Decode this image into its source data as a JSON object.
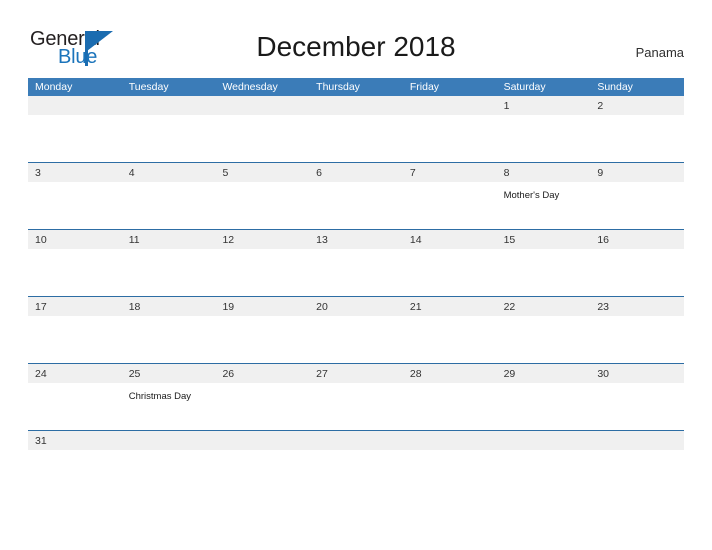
{
  "logo": {
    "text_primary": "General",
    "text_secondary": "Blue",
    "triangle_icon": "triangle-icon"
  },
  "header": {
    "title": "December 2018",
    "country": "Panama"
  },
  "colors": {
    "header_blue": "#3b7cb8",
    "row_border_blue": "#2d6da4",
    "date_band_gray": "#f0f0f0",
    "logo_blue": "#1b74bb",
    "text_dark": "#333333"
  },
  "calendar": {
    "month": "December",
    "year": "2018",
    "weekdays": [
      "Monday",
      "Tuesday",
      "Wednesday",
      "Thursday",
      "Friday",
      "Saturday",
      "Sunday"
    ],
    "weeks": [
      {
        "days": [
          {
            "num": "",
            "event": ""
          },
          {
            "num": "",
            "event": ""
          },
          {
            "num": "",
            "event": ""
          },
          {
            "num": "",
            "event": ""
          },
          {
            "num": "",
            "event": ""
          },
          {
            "num": "1",
            "event": ""
          },
          {
            "num": "2",
            "event": ""
          }
        ]
      },
      {
        "days": [
          {
            "num": "3",
            "event": ""
          },
          {
            "num": "4",
            "event": ""
          },
          {
            "num": "5",
            "event": ""
          },
          {
            "num": "6",
            "event": ""
          },
          {
            "num": "7",
            "event": ""
          },
          {
            "num": "8",
            "event": "Mother's Day"
          },
          {
            "num": "9",
            "event": ""
          }
        ]
      },
      {
        "days": [
          {
            "num": "10",
            "event": ""
          },
          {
            "num": "11",
            "event": ""
          },
          {
            "num": "12",
            "event": ""
          },
          {
            "num": "13",
            "event": ""
          },
          {
            "num": "14",
            "event": ""
          },
          {
            "num": "15",
            "event": ""
          },
          {
            "num": "16",
            "event": ""
          }
        ]
      },
      {
        "days": [
          {
            "num": "17",
            "event": ""
          },
          {
            "num": "18",
            "event": ""
          },
          {
            "num": "19",
            "event": ""
          },
          {
            "num": "20",
            "event": ""
          },
          {
            "num": "21",
            "event": ""
          },
          {
            "num": "22",
            "event": ""
          },
          {
            "num": "23",
            "event": ""
          }
        ]
      },
      {
        "days": [
          {
            "num": "24",
            "event": ""
          },
          {
            "num": "25",
            "event": "Christmas Day"
          },
          {
            "num": "26",
            "event": ""
          },
          {
            "num": "27",
            "event": ""
          },
          {
            "num": "28",
            "event": ""
          },
          {
            "num": "29",
            "event": ""
          },
          {
            "num": "30",
            "event": ""
          }
        ]
      },
      {
        "days": [
          {
            "num": "31",
            "event": ""
          },
          {
            "num": "",
            "event": ""
          },
          {
            "num": "",
            "event": ""
          },
          {
            "num": "",
            "event": ""
          },
          {
            "num": "",
            "event": ""
          },
          {
            "num": "",
            "event": ""
          },
          {
            "num": "",
            "event": ""
          }
        ]
      }
    ]
  }
}
